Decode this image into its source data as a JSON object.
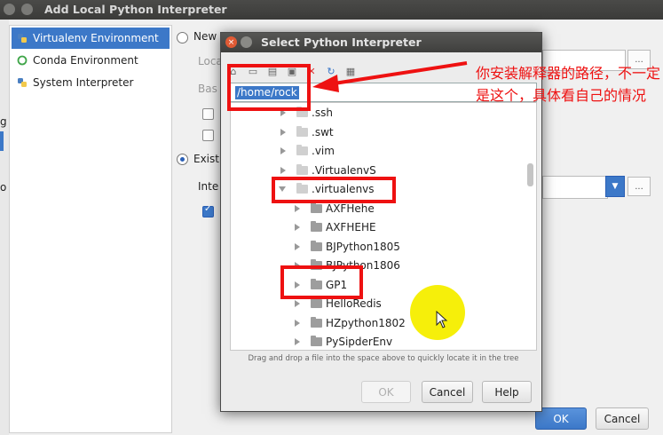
{
  "window": {
    "title": "Add Local Python Interpreter"
  },
  "sidebar": {
    "items": [
      {
        "label": "Virtualenv Environment",
        "icon": "python-icon",
        "selected": true
      },
      {
        "label": "Conda Environment",
        "icon": "conda-icon",
        "selected": false
      },
      {
        "label": "System Interpreter",
        "icon": "python-icon",
        "selected": false
      }
    ]
  },
  "main": {
    "new_label": "New",
    "location_label": "Loca",
    "base_label": "Bas",
    "existing_label": "Exist",
    "interpreter_label": "Inte",
    "dots": "..."
  },
  "outer_buttons": {
    "ok": "OK",
    "cancel": "Cancel"
  },
  "left_edge": {
    "a": "g",
    "b": "o"
  },
  "dialog": {
    "title": "Select Python Interpreter",
    "path": "/home/rock",
    "tree": [
      {
        "label": ".ssh",
        "level": 0,
        "hidden": true
      },
      {
        "label": ".swt",
        "level": 0,
        "hidden": true
      },
      {
        "label": ".vim",
        "level": 0,
        "hidden": true
      },
      {
        "label": ".VirtualenvS",
        "level": 0,
        "hidden": true
      },
      {
        "label": ".virtualenvs",
        "level": 0,
        "hidden": true,
        "expanded": true
      },
      {
        "label": "AXFHehe",
        "level": 1
      },
      {
        "label": "AXFHEHE",
        "level": 1
      },
      {
        "label": "BJPython1805",
        "level": 1
      },
      {
        "label": "BJPython1806",
        "level": 1
      },
      {
        "label": "GP1",
        "level": 1
      },
      {
        "label": "HelloRedis",
        "level": 1
      },
      {
        "label": "HZpython1802",
        "level": 1
      },
      {
        "label": "PySipderEnv",
        "level": 1
      }
    ],
    "hint": "Drag and drop a file into the space above to quickly locate it in the tree",
    "buttons": {
      "ok": "OK",
      "cancel": "Cancel",
      "help": "Help"
    }
  },
  "annotation": {
    "text": "你安装解释器的路径，不一定是这个，具体看自己的情况"
  },
  "colors": {
    "accent": "#3c78c8",
    "annotation_red": "#ee1111",
    "cursor_highlight": "#f6ef0a"
  }
}
